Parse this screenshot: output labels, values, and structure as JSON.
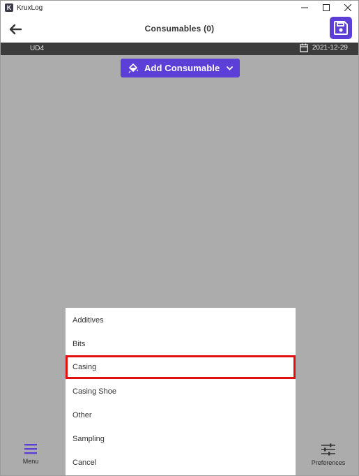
{
  "window": {
    "app_logo_letter": "K",
    "title": "KruxLog"
  },
  "header": {
    "title": "Consumables (0)"
  },
  "info_bar": {
    "project_code": "UD4",
    "date": "2021-12-29"
  },
  "add_button": {
    "label": "Add Consumable"
  },
  "dropdown": {
    "items": [
      "Additives",
      "Bits",
      "Casing",
      "Casing Shoe",
      "Other",
      "Sampling",
      "Cancel"
    ],
    "highlighted_item": "Casing"
  },
  "bottom_nav": {
    "menu_label": "Menu",
    "preferences_label": "Preferences"
  },
  "colors": {
    "accent": "#5b3fd6",
    "overlay": "#acacac",
    "info_bar": "#3c3c3c",
    "highlight_outline": "#e01010"
  },
  "icons": {
    "back": "arrow-left-icon",
    "save": "floppy-disk-icon",
    "calendar": "calendar-icon",
    "add": "paint-bucket-icon",
    "dropdown": "chevron-down-icon",
    "menu": "hamburger-icon",
    "preferences": "sliders-icon"
  }
}
